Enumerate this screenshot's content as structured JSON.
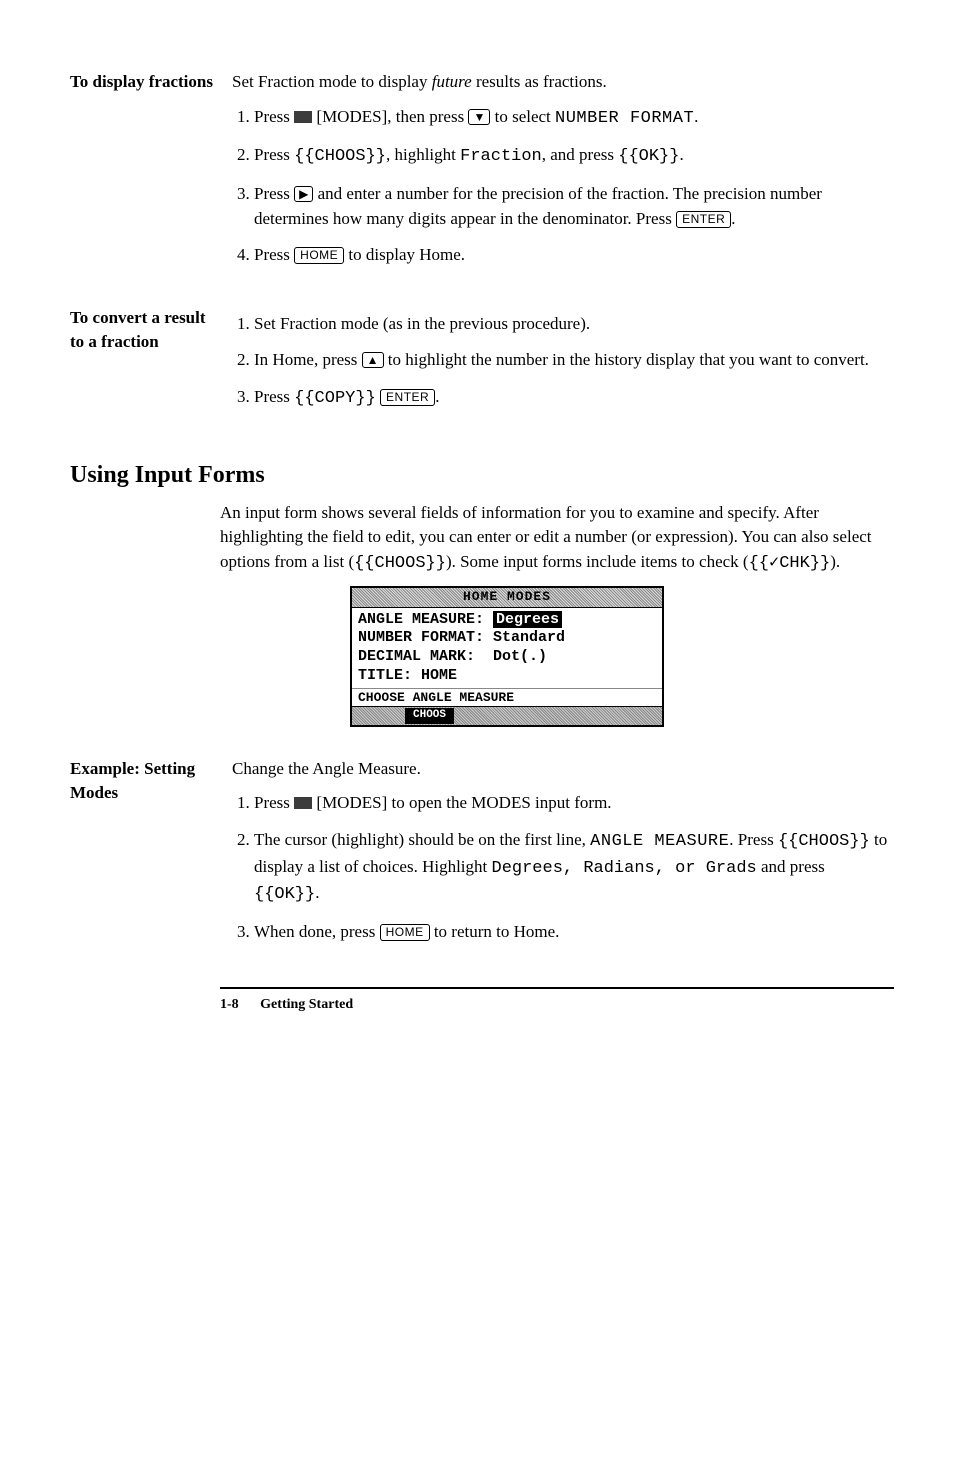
{
  "sec1": {
    "sidehead": "To display fractions",
    "intro_a": "Set Fraction mode to display ",
    "intro_em": "future",
    "intro_b": " results as fractions.",
    "li1_a": "Press ",
    "li1_modes": " [MODES]",
    "li1_b": ", then press ",
    "li1_down": "▼",
    "li1_c": " to select ",
    "li1_num": "NUMBER FORMAT",
    "li1_d": ".",
    "li2_a": "Press ",
    "li2_choos": "{{CHOOS}}",
    "li2_b": ", highlight ",
    "li2_frac": "Fraction",
    "li2_c": ", and press ",
    "li2_ok": "{{OK}}",
    "li2_d": ".",
    "li3_a": "Press ",
    "li3_right": "▶",
    "li3_b": " and enter a number for the precision of the fraction. The precision number determines how many digits appear in the denominator. Press ",
    "li3_enter": "ENTER",
    "li3_c": ".",
    "li4_a": "Press ",
    "li4_home": "HOME",
    "li4_b": " to display Home."
  },
  "sec2": {
    "sidehead": "To convert a result to a fraction",
    "li1": "Set Fraction mode (as in the previous procedure).",
    "li2_a": "In Home, press ",
    "li2_up": "▲",
    "li2_b": " to highlight the number in the history display that you want to convert.",
    "li3_a": "Press ",
    "li3_copy": "{{COPY}}",
    "li3_sp": " ",
    "li3_enter": "ENTER",
    "li3_b": "."
  },
  "heading2": "Using Input Forms",
  "intro2_a": "An input form shows several fields of information for you to examine and specify. After highlighting the field to edit, you can enter or edit a number (or expression). You can also select options from a list (",
  "intro2_choos": "{{CHOOS}}",
  "intro2_b": "). Some input forms include items to check (",
  "intro2_chk": "{{✓CHK}}",
  "intro2_c": ").",
  "screen": {
    "title": "HOME MODES",
    "l1_lbl": "ANGLE MEASURE:",
    "l1_val": "Degrees",
    "l2_lbl": "NUMBER FORMAT:",
    "l2_val": "Standard",
    "l3_lbl": "DECIMAL MARK:",
    "l3_val": "Dot(.)",
    "l4_lbl": "TITLE:",
    "l4_val": "HOME",
    "hint": "CHOOSE ANGLE MEASURE",
    "soft1": "",
    "soft2": "CHOOS",
    "soft3": "",
    "soft4": "",
    "soft5": "",
    "soft6": ""
  },
  "sec3": {
    "sidehead": "Example: Setting Modes",
    "intro": "Change the Angle Measure.",
    "li1_a": "Press ",
    "li1_modes": " [MODES]",
    "li1_b": " to open the MODES input form.",
    "li2_a": "The cursor (highlight) should be on the first line, ",
    "li2_am": "ANGLE MEASURE",
    "li2_b": ". Press ",
    "li2_choos": "{{CHOOS}}",
    "li2_c": " to display a list of choices. Highlight ",
    "li2_opts": "Degrees, Radians, or Grads",
    "li2_d": " and press ",
    "li2_ok": "{{OK}}",
    "li2_e": ".",
    "li3_a": "When done, press ",
    "li3_home": "HOME",
    "li3_b": " to return to Home."
  },
  "footer": {
    "page": "1-8",
    "chapter": "Getting Started"
  }
}
